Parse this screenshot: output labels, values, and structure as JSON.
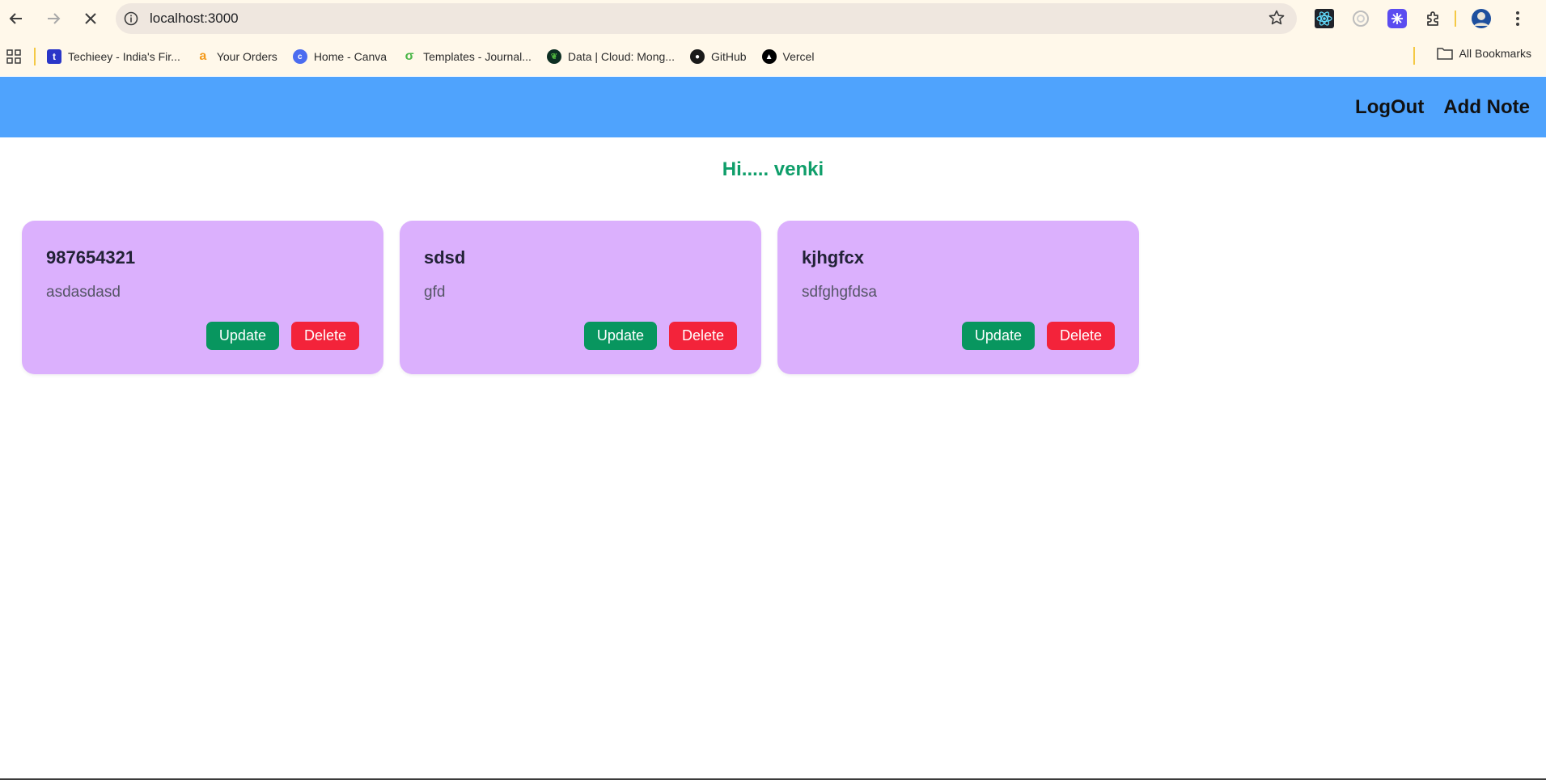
{
  "browser": {
    "url": "localhost:3000",
    "bookmarks": [
      {
        "label": "Techieey - India's Fir...",
        "icon": "techieey-icon",
        "color": "#2a36c8",
        "glyph": "t"
      },
      {
        "label": "Your Orders",
        "icon": "amazon-icon",
        "color": "#f39a1c",
        "glyph": "a"
      },
      {
        "label": "Home - Canva",
        "icon": "canva-icon",
        "color": "#4b6cf0",
        "glyph": "c"
      },
      {
        "label": "Templates - Journal...",
        "icon": "journal-icon",
        "color": "#4ab648",
        "glyph": "σ"
      },
      {
        "label": "Data | Cloud: Mong...",
        "icon": "mongodb-icon",
        "color": "#0d2e22",
        "glyph": "❦"
      },
      {
        "label": "GitHub",
        "icon": "github-icon",
        "color": "#1a1a1a",
        "glyph": "●"
      },
      {
        "label": "Vercel",
        "icon": "vercel-icon",
        "color": "#000000",
        "glyph": "▲"
      }
    ],
    "all_bookmarks": "All Bookmarks"
  },
  "app": {
    "nav": {
      "logout": "LogOut",
      "add_note": "Add Note"
    },
    "greeting": "Hi..... venki",
    "colors": {
      "appbar": "#4fa3fd",
      "card": "#dbb0fd",
      "update": "#08965f",
      "delete": "#f3233a",
      "greeting": "#0f9e6a"
    },
    "notes": [
      {
        "title": "987654321",
        "body": "asdasdasd",
        "update_label": "Update",
        "delete_label": "Delete"
      },
      {
        "title": "sdsd",
        "body": "gfd",
        "update_label": "Update",
        "delete_label": "Delete"
      },
      {
        "title": "kjhgfcx",
        "body": "sdfghgfdsa",
        "update_label": "Update",
        "delete_label": "Delete"
      }
    ]
  }
}
